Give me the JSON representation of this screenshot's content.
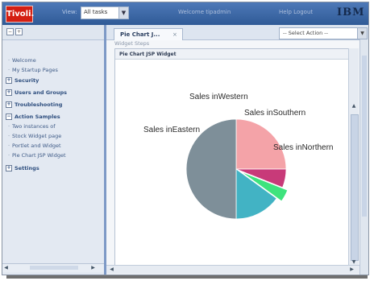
{
  "header": {
    "logo": "Tivoli.",
    "view_label": "View:",
    "view_value": "All tasks",
    "welcome": "Welcome tipadmin",
    "help_logout": "Help  Logout",
    "brand": "IBM"
  },
  "sidebar": {
    "items": [
      {
        "label": "Welcome",
        "type": "link"
      },
      {
        "label": "My Startup Pages",
        "type": "link"
      },
      {
        "label": "Security",
        "type": "category"
      },
      {
        "label": "Users and Groups",
        "type": "category"
      },
      {
        "label": "Troubleshooting",
        "type": "category"
      },
      {
        "label": "Action Samples",
        "type": "category"
      },
      {
        "label": "Two instances of",
        "type": "link"
      },
      {
        "label": "Stock Widget page",
        "type": "link"
      },
      {
        "label": "Portlet and Widget",
        "type": "link"
      },
      {
        "label": "Pie Chart JSP Widget",
        "type": "link"
      },
      {
        "label": "Settings",
        "type": "category"
      }
    ]
  },
  "main": {
    "tab_label": "Pie Chart J...",
    "tab_close": "×",
    "action_select": "-- Select Action --",
    "widget_title": "Widget Steps",
    "widget_header": "Pie Chart JSP Widget"
  },
  "chart_data": {
    "type": "pie",
    "title": "",
    "slices": [
      {
        "label": "Sales inSouthern",
        "value": 25,
        "color": "#f4a3a8"
      },
      {
        "label": "Sales inNorthern",
        "value": 6,
        "color": "#c83a79"
      },
      {
        "label": "Sales inWestern",
        "value": 4,
        "color": "#3ee37d"
      },
      {
        "label": "Sales inEastern",
        "value": 15,
        "color": "#42b3c4"
      },
      {
        "label": "",
        "value": 50,
        "color": "#7e8f99"
      }
    ]
  }
}
